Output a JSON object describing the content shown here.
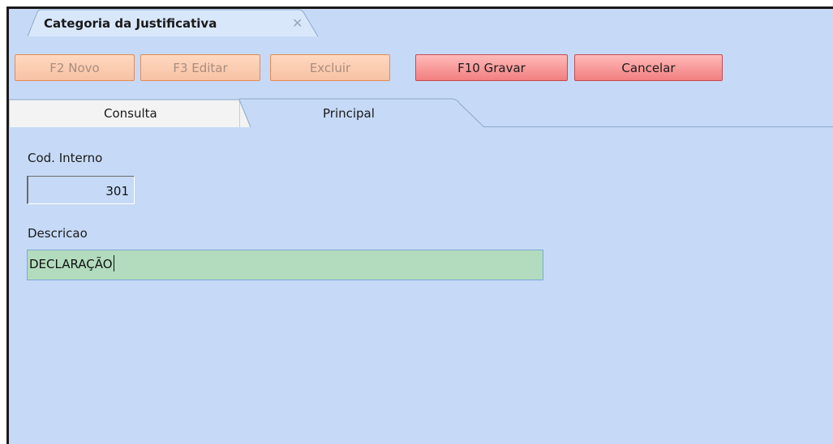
{
  "window": {
    "tab_title": "Categoria da Justificativa",
    "tab_close_icon": "close-icon"
  },
  "toolbar": {
    "new_label": "F2 Novo",
    "edit_label": "F3 Editar",
    "delete_label": "Excluir",
    "save_label": "F10 Gravar",
    "cancel_label": "Cancelar"
  },
  "tabs": [
    {
      "label": "Consulta",
      "active": false
    },
    {
      "label": "Principal",
      "active": true
    }
  ],
  "form": {
    "code_label": "Cod. Interno",
    "code_value": "301",
    "description_label": "Descricao",
    "description_value": "DECLARAÇÃO"
  },
  "colors": {
    "background": "#c6daf7",
    "disabled_button": "#f7c2a4",
    "active_button": "#f27f80",
    "focused_input": "#b3dcbe"
  }
}
